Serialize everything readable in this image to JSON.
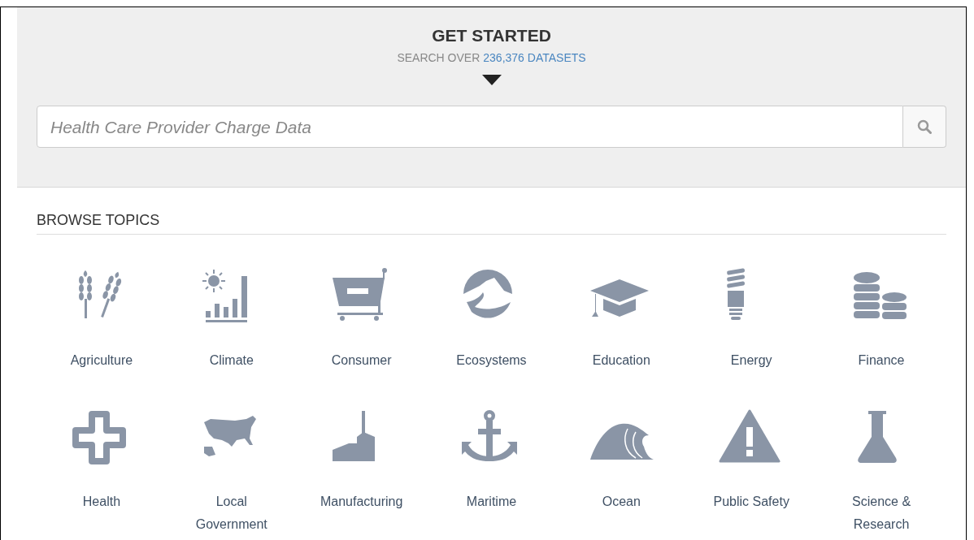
{
  "header": {
    "title": "GET STARTED",
    "subtitle_prefix": "SEARCH OVER",
    "dataset_count": "236,376 DATASETS"
  },
  "search": {
    "placeholder": "Health Care Provider Charge Data"
  },
  "browse": {
    "heading": "BROWSE TOPICS",
    "topics": [
      {
        "label": "Agriculture"
      },
      {
        "label": "Climate"
      },
      {
        "label": "Consumer"
      },
      {
        "label": "Ecosystems"
      },
      {
        "label": "Education"
      },
      {
        "label": "Energy"
      },
      {
        "label": "Finance"
      },
      {
        "label": "Health"
      },
      {
        "label": "Local Government"
      },
      {
        "label": "Manufacturing"
      },
      {
        "label": "Maritime"
      },
      {
        "label": "Ocean"
      },
      {
        "label": "Public Safety"
      },
      {
        "label": "Science & Research"
      }
    ]
  }
}
